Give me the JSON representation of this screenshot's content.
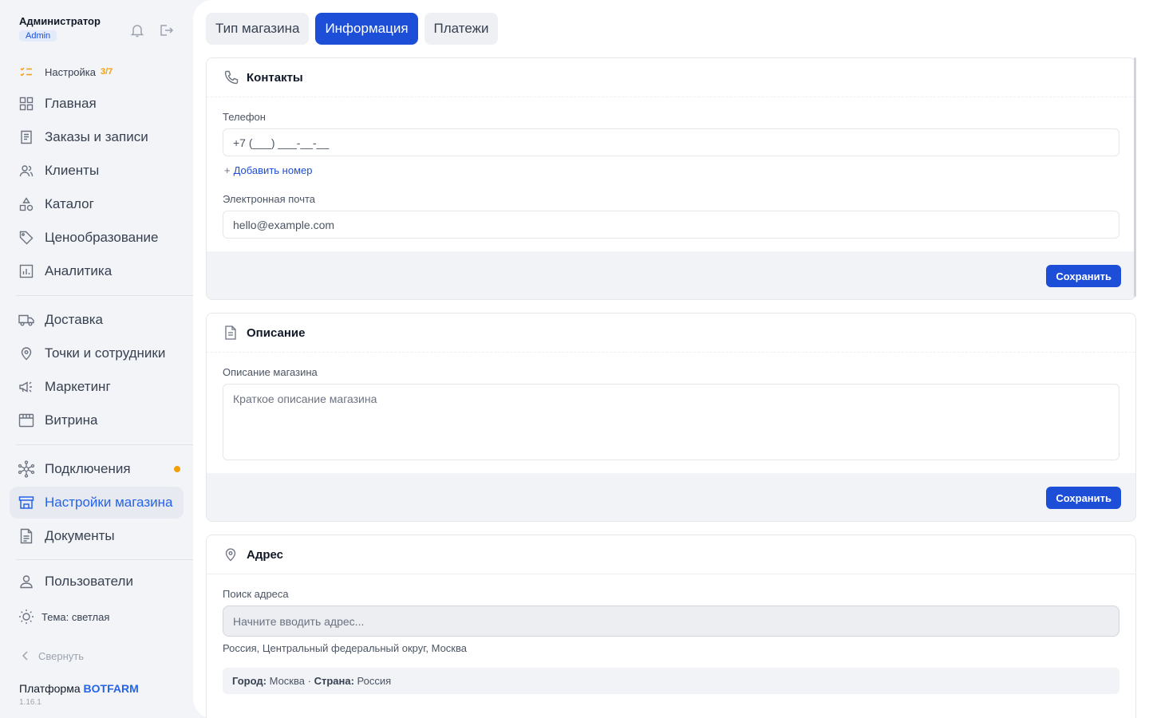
{
  "user": {
    "name": "Администратор",
    "role": "Admin"
  },
  "nav": {
    "setup": {
      "label": "Настройка",
      "progress": "3/7"
    },
    "items": [
      {
        "label": "Главная"
      },
      {
        "label": "Заказы и записи"
      },
      {
        "label": "Клиенты"
      },
      {
        "label": "Каталог"
      },
      {
        "label": "Ценообразование"
      },
      {
        "label": "Аналитика"
      },
      {
        "label": "Доставка"
      },
      {
        "label": "Точки и сотрудники"
      },
      {
        "label": "Маркетинг"
      },
      {
        "label": "Витрина"
      },
      {
        "label": "Подключения"
      },
      {
        "label": "Настройки магазина"
      },
      {
        "label": "Документы"
      },
      {
        "label": "Пользователи"
      }
    ],
    "theme": "Тема: светлая",
    "collapse": "Свернуть"
  },
  "platform": {
    "prefix": "Платформа ",
    "brand": "BOTFARM",
    "version": "1.16.1"
  },
  "tabs": [
    {
      "label": "Тип магазина"
    },
    {
      "label": "Информация"
    },
    {
      "label": "Платежи"
    }
  ],
  "contacts": {
    "title": "Контакты",
    "phone_label": "Телефон",
    "phone_placeholder": "+7 (___) ___-__-__",
    "add_phone": "Добавить номер",
    "email_label": "Электронная почта",
    "email_placeholder": "hello@example.com",
    "save": "Сохранить"
  },
  "description": {
    "title": "Описание",
    "field_label": "Описание магазина",
    "placeholder": "Краткое описание магазина",
    "save": "Сохранить"
  },
  "address": {
    "title": "Адрес",
    "search_label": "Поиск адреса",
    "search_placeholder": "Начните вводить адрес...",
    "full": "Россия, Центральный федеральный округ, Москва",
    "city_label": "Город:",
    "city": "Москва",
    "sep": "·",
    "country_label": "Страна:",
    "country": "Россия"
  },
  "colors": {
    "accent": "#1d4ed8",
    "warning": "#f59e0b"
  }
}
